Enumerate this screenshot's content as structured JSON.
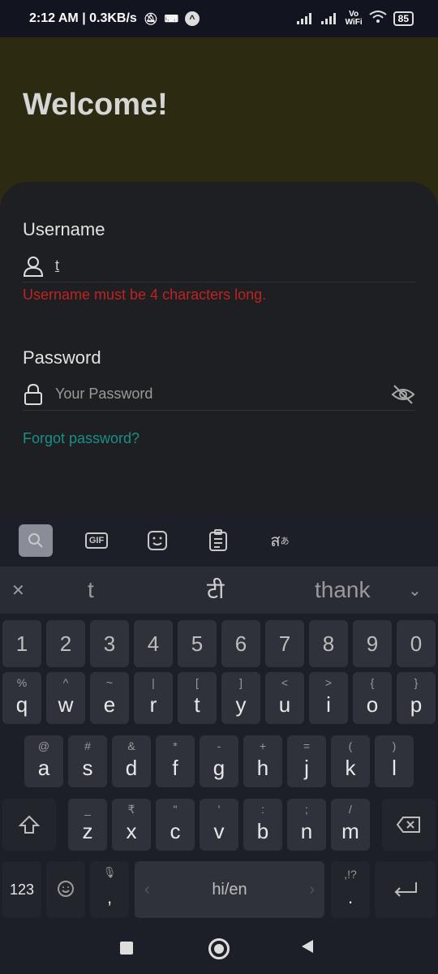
{
  "status_bar": {
    "time_speed": "2:12 AM | 0.3KB/s",
    "vowifi_top": "Vo",
    "vowifi_bottom": "WiFi",
    "battery": "85"
  },
  "app": {
    "title": "Welcome!",
    "username": {
      "label": "Username",
      "value": "t",
      "error": "Username must be 4 characters long."
    },
    "password": {
      "label": "Password",
      "placeholder": "Your Password"
    },
    "forgot_link": "Forgot password?"
  },
  "keyboard": {
    "toolbar": {
      "gif_label": "GIF"
    },
    "suggestions": [
      "t",
      "टी",
      "thank"
    ],
    "number_row": [
      "1",
      "2",
      "3",
      "4",
      "5",
      "6",
      "7",
      "8",
      "9",
      "0"
    ],
    "row1": [
      {
        "main": "q",
        "sub": "%"
      },
      {
        "main": "w",
        "sub": "^"
      },
      {
        "main": "e",
        "sub": "~"
      },
      {
        "main": "r",
        "sub": "|"
      },
      {
        "main": "t",
        "sub": "["
      },
      {
        "main": "y",
        "sub": "]"
      },
      {
        "main": "u",
        "sub": "<"
      },
      {
        "main": "i",
        "sub": ">"
      },
      {
        "main": "o",
        "sub": "{"
      },
      {
        "main": "p",
        "sub": "}"
      }
    ],
    "row2": [
      {
        "main": "a",
        "sub": "@"
      },
      {
        "main": "s",
        "sub": "#"
      },
      {
        "main": "d",
        "sub": "&"
      },
      {
        "main": "f",
        "sub": "*"
      },
      {
        "main": "g",
        "sub": "-"
      },
      {
        "main": "h",
        "sub": "+"
      },
      {
        "main": "j",
        "sub": "="
      },
      {
        "main": "k",
        "sub": "("
      },
      {
        "main": "l",
        "sub": ")"
      }
    ],
    "row3": [
      {
        "main": "z",
        "sub": "_"
      },
      {
        "main": "x",
        "sub": "₹"
      },
      {
        "main": "c",
        "sub": "\""
      },
      {
        "main": "v",
        "sub": "'"
      },
      {
        "main": "b",
        "sub": ":"
      },
      {
        "main": "n",
        "sub": ";"
      },
      {
        "main": "m",
        "sub": "/"
      }
    ],
    "bottom": {
      "numbers_key": "123",
      "comma_key": ",",
      "space_label": "hi/en",
      "period_sub": ",!?",
      "period_key": "."
    }
  }
}
